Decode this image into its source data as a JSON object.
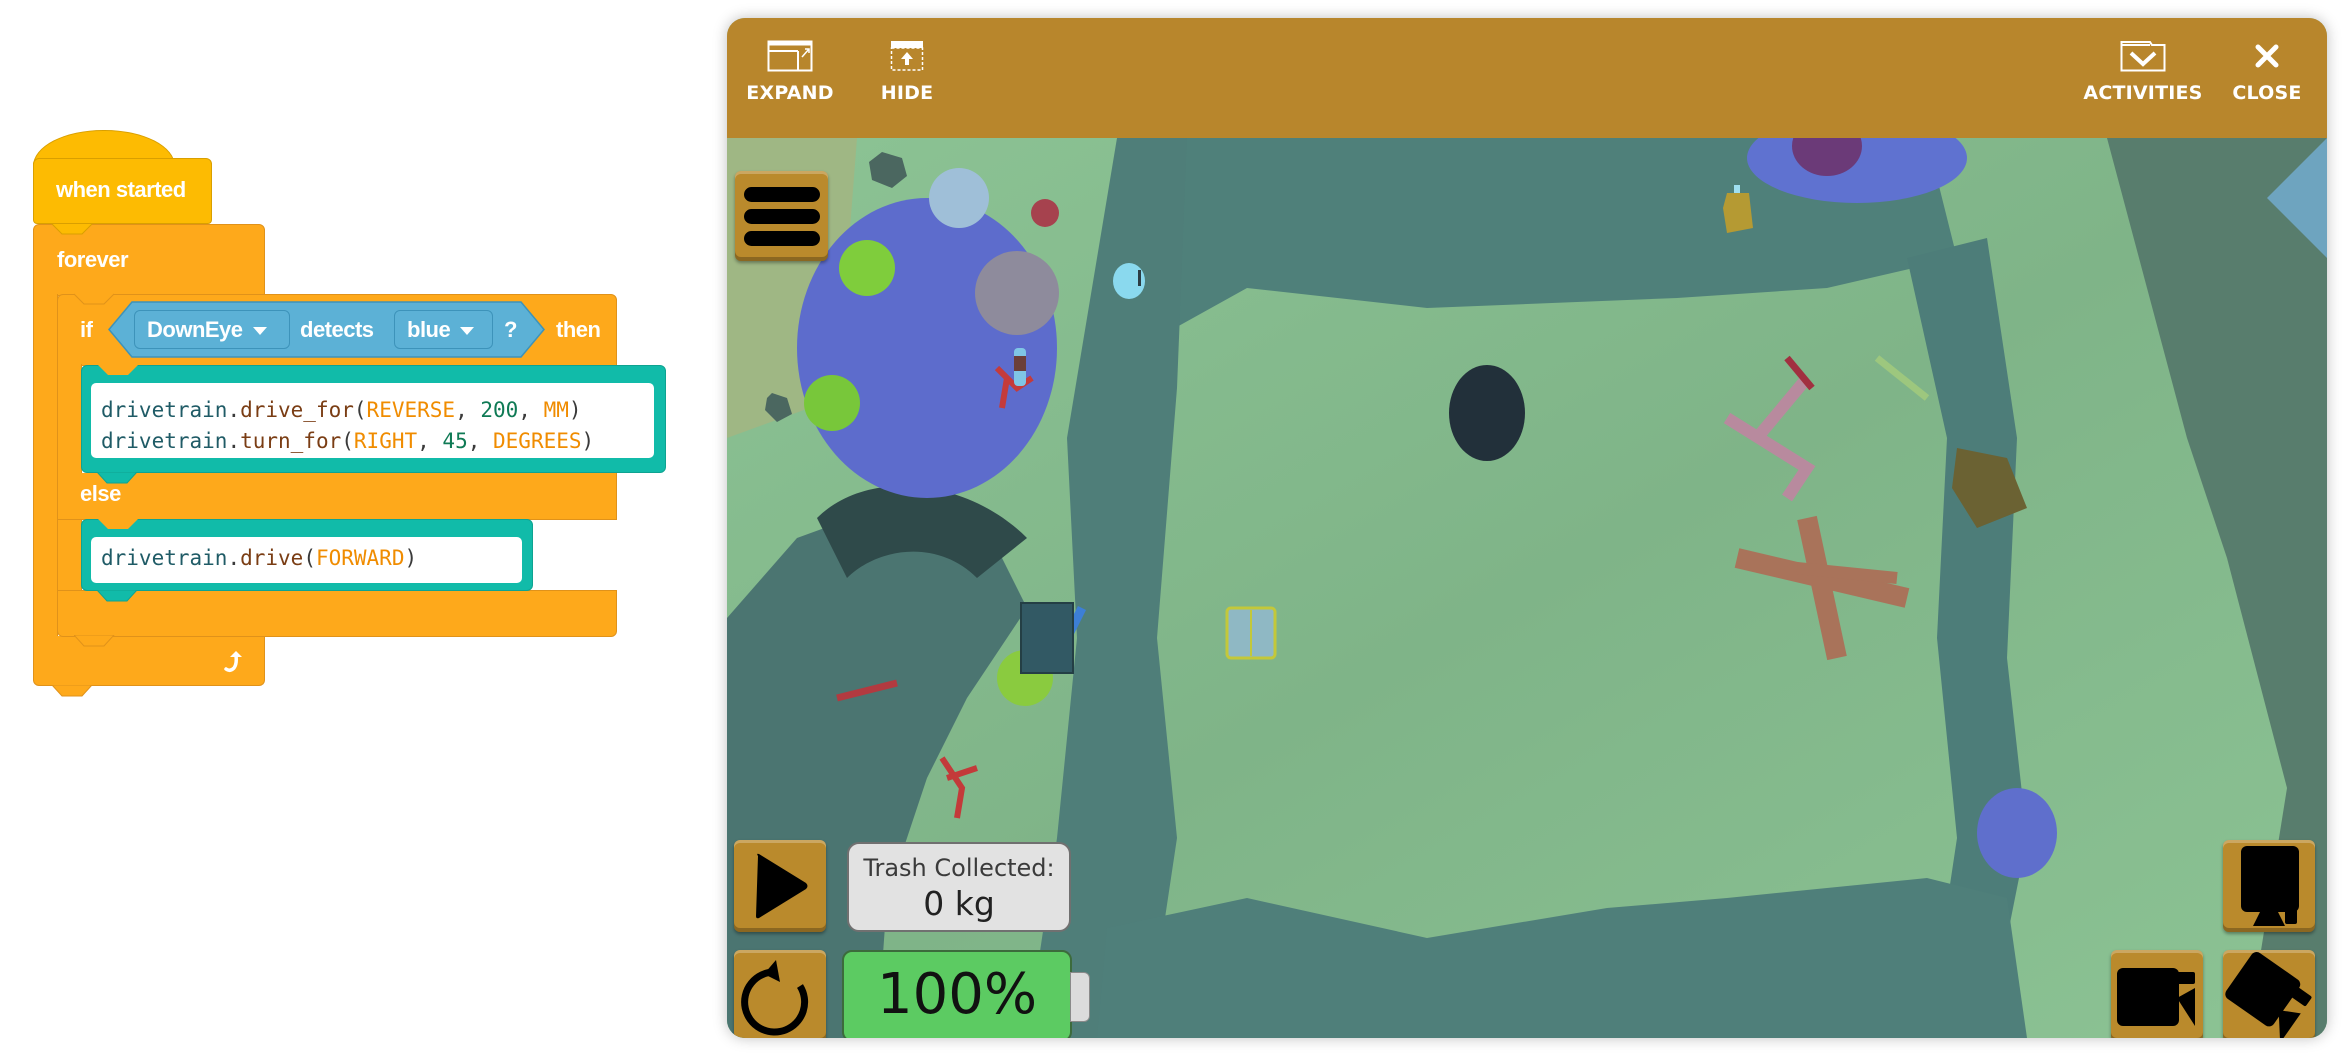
{
  "blocks": {
    "hat": {
      "label": "when started",
      "color": "#fdbb02"
    },
    "forever": {
      "label": "forever",
      "color": "#fea91b",
      "loop_icon": "loop-arrow-icon"
    },
    "if_block": {
      "if_label": "if",
      "then_label": "then",
      "else_label": "else",
      "condition": {
        "sensor": "DownEye",
        "verb": "detects",
        "color_value": "blue",
        "suffix": "?",
        "color": "#5cb1d6"
      }
    },
    "then_code": {
      "color": "#11bba9",
      "lines": [
        {
          "obj": "drivetrain",
          "fn": "drive_for",
          "args": [
            {
              "t": "kw",
              "v": "REVERSE"
            },
            {
              "t": "num",
              "v": "200"
            },
            {
              "t": "kw",
              "v": "MM"
            }
          ]
        },
        {
          "obj": "drivetrain",
          "fn": "turn_for",
          "args": [
            {
              "t": "kw",
              "v": "RIGHT"
            },
            {
              "t": "num",
              "v": "45"
            },
            {
              "t": "kw",
              "v": "DEGREES"
            }
          ]
        }
      ]
    },
    "else_code": {
      "lines": [
        {
          "obj": "drivetrain",
          "fn": "drive",
          "args": [
            {
              "t": "kw",
              "v": "FORWARD"
            }
          ]
        }
      ]
    }
  },
  "simulator": {
    "toolbar": {
      "color": "#b8862c",
      "expand": {
        "label": "EXPAND",
        "icon": "expand-window-icon"
      },
      "hide": {
        "label": "HIDE",
        "icon": "hide-panel-icon"
      },
      "activities": {
        "label": "ACTIVITIES",
        "icon": "activities-folder-icon"
      },
      "close": {
        "label": "CLOSE",
        "icon": "close-icon"
      }
    },
    "menu_button": {
      "icon": "hamburger-menu-icon"
    },
    "play_button": {
      "icon": "play-icon"
    },
    "reset_button": {
      "icon": "reset-icon"
    },
    "trash": {
      "label": "Trash Collected:",
      "value": "0 kg"
    },
    "battery": {
      "label": "100%",
      "level_percent": 100,
      "color": "#5ccb62"
    },
    "camera_buttons": [
      {
        "name": "top-camera",
        "icon": "top-view-camera-icon"
      },
      {
        "name": "side-camera",
        "icon": "side-view-camera-icon"
      },
      {
        "name": "angled-camera",
        "icon": "angled-view-camera-icon"
      }
    ],
    "scene": {
      "water_color": "#86be8e",
      "rock_color": "#4f7d78",
      "coral_color": "#5b6ccc",
      "objects": [
        "robot",
        "plastic-bottle",
        "detergent-jug",
        "dark-tire",
        "trash-bin",
        "supply-crate",
        "airplane-wreck",
        "coral-reef"
      ]
    }
  }
}
